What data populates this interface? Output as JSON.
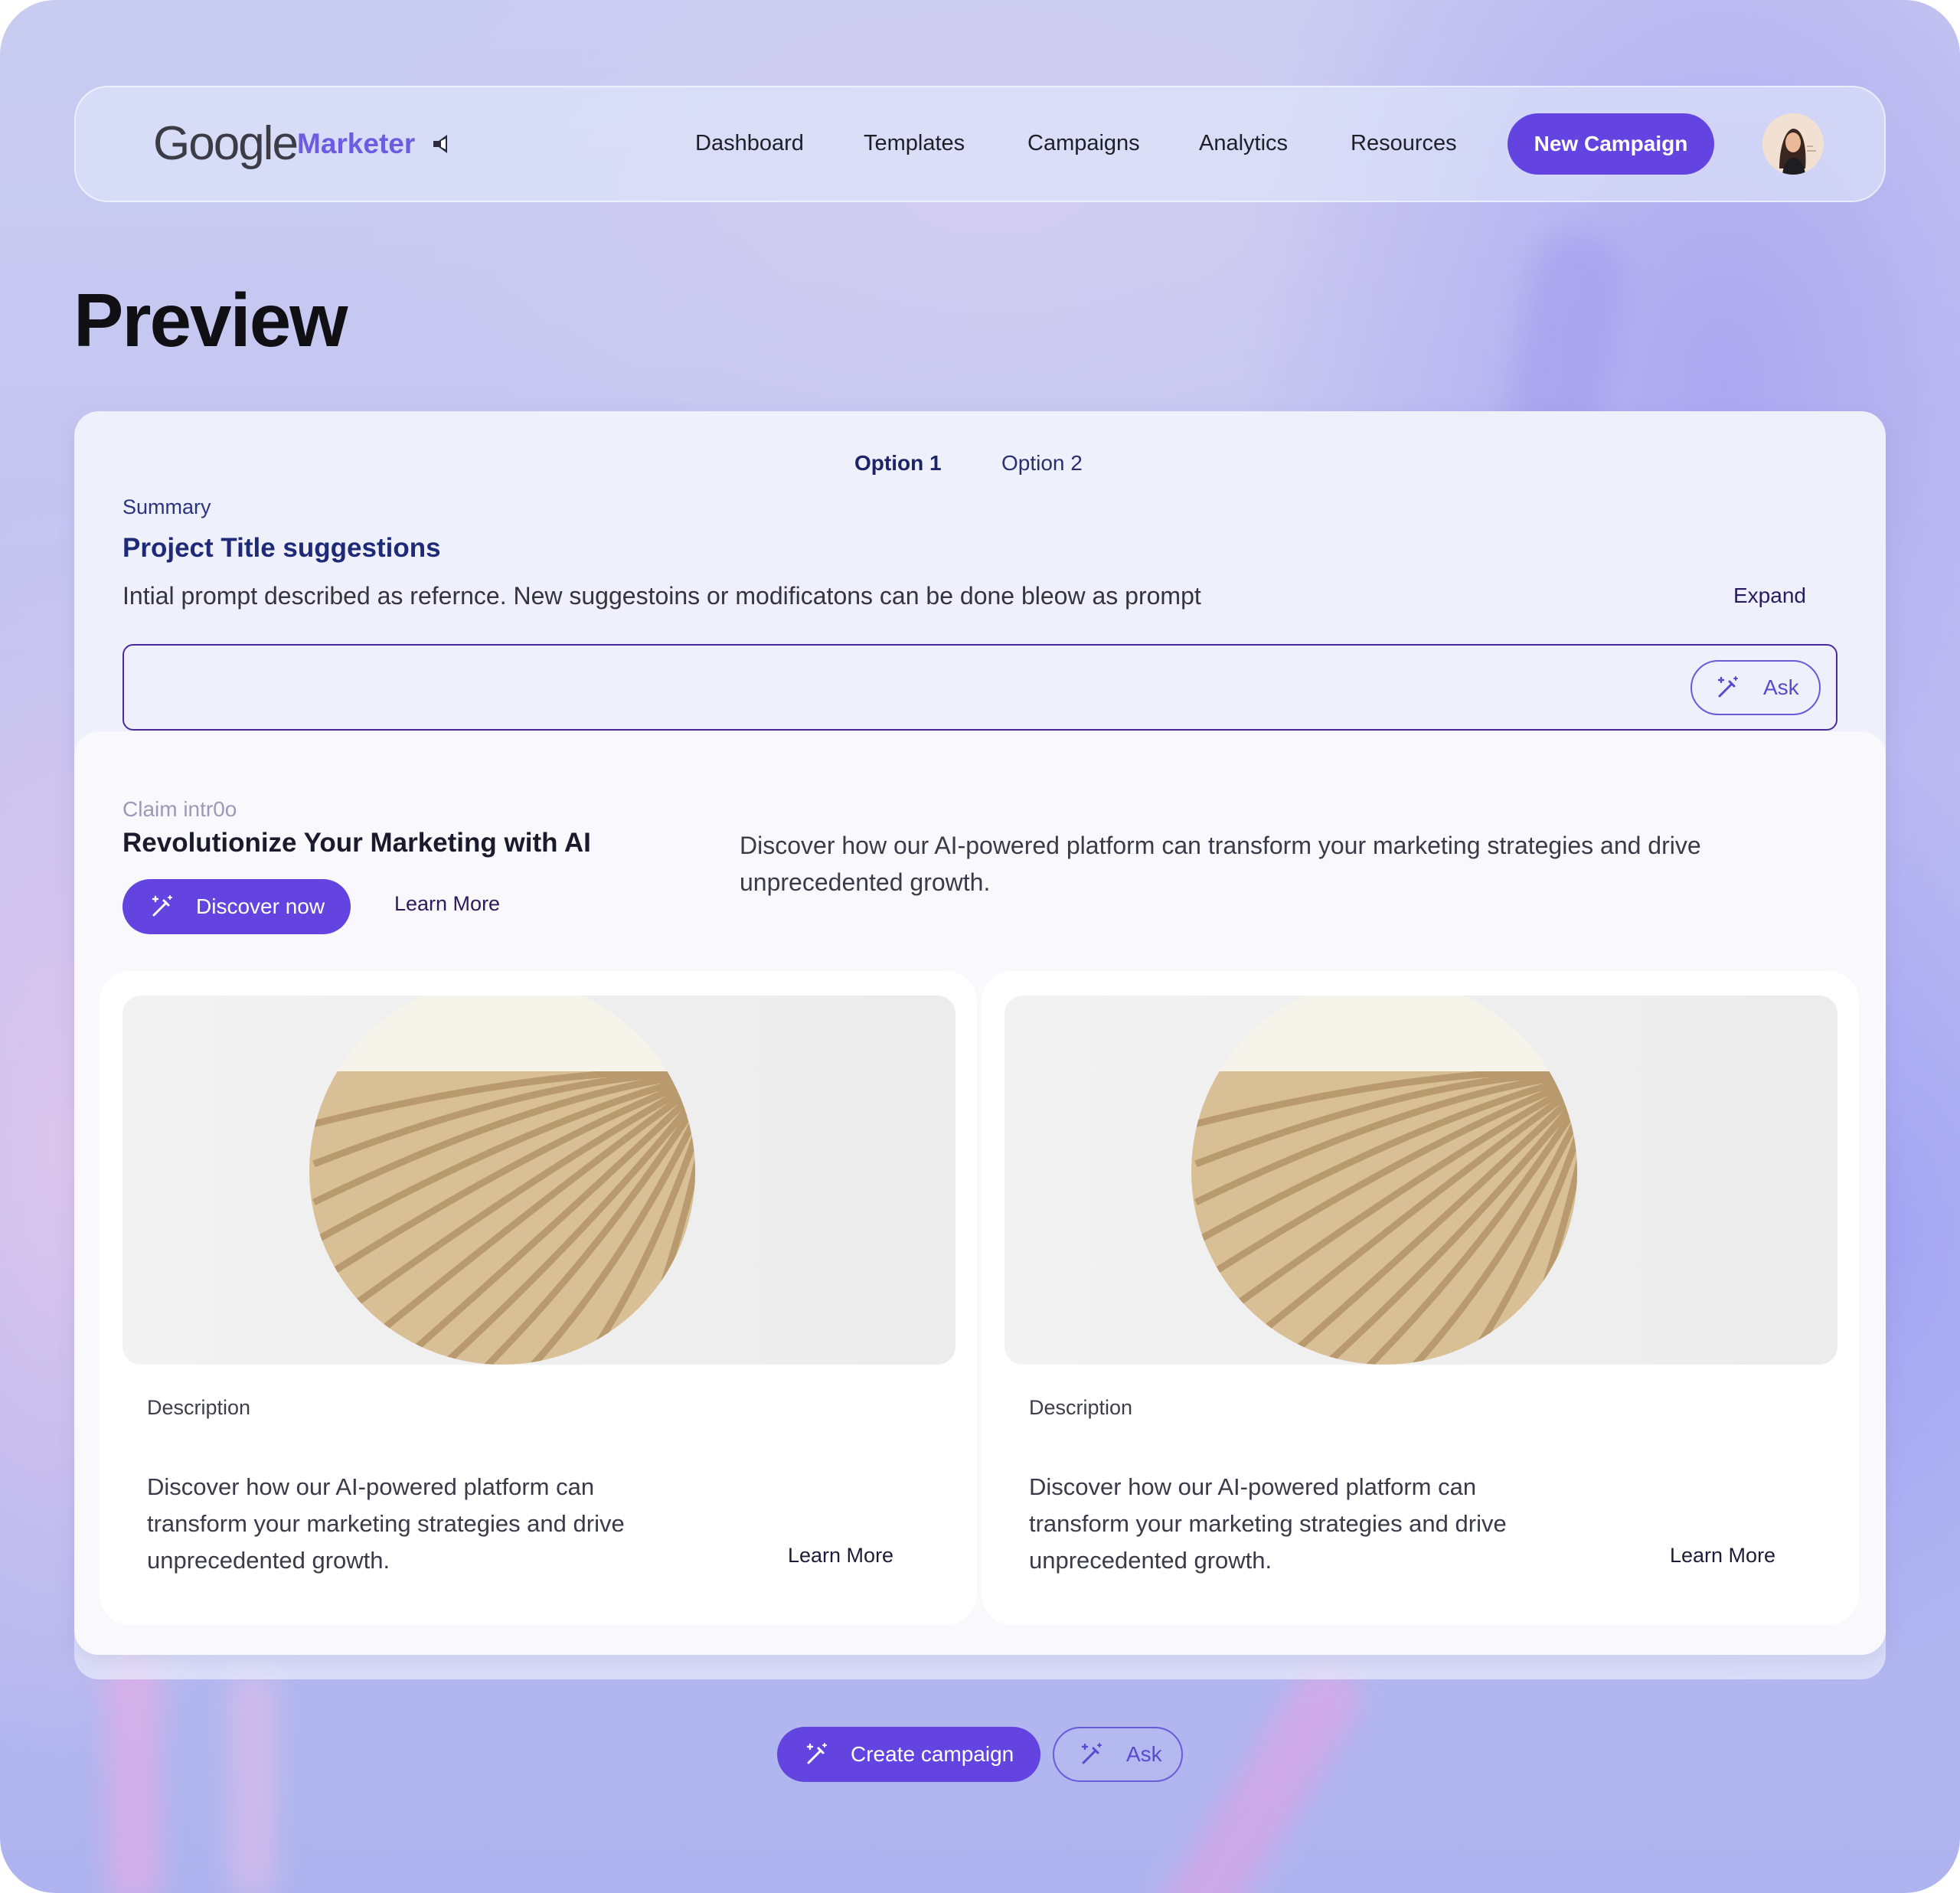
{
  "app": {
    "logo_google": "Google",
    "logo_product": "Marketer",
    "accent_color": "#6444e0"
  },
  "nav": {
    "links": [
      "Dashboard",
      "Templates",
      "Campaigns",
      "Analytics",
      "Resources"
    ],
    "new_campaign_label": "New Campaign"
  },
  "page": {
    "title": "Preview"
  },
  "options": {
    "tabs": [
      "Option 1",
      "Option 2"
    ],
    "active_index": 0
  },
  "summary": {
    "label": "Summary",
    "title": "Project Title suggestions",
    "description": "Intial prompt described as refernce. New suggestoins or modificatons can be done bleow as prompt",
    "expand_label": "Expand",
    "input_value": "",
    "ask_label": "Ask"
  },
  "claim": {
    "label": "Claim intr0o",
    "title": "Revolutionize Your Marketing with AI",
    "description": "Discover how our AI-powered platform can transform your marketing strategies and drive unprecedented growth.",
    "discover_label": "Discover now",
    "learn_more_label": "Learn More"
  },
  "cards": [
    {
      "image_icon": "sculpture-image",
      "desc_label": "Description",
      "desc_text": "Discover how our AI-powered platform can transform your marketing strategies and drive unprecedented growth.",
      "learn_more_label": "Learn More"
    },
    {
      "image_icon": "sculpture-image",
      "desc_label": "Description",
      "desc_text": "Discover how our AI-powered platform can transform your marketing strategies and drive unprecedented growth.",
      "learn_more_label": "Learn More"
    }
  ],
  "footer": {
    "create_label": "Create campaign",
    "ask_label": "Ask"
  }
}
